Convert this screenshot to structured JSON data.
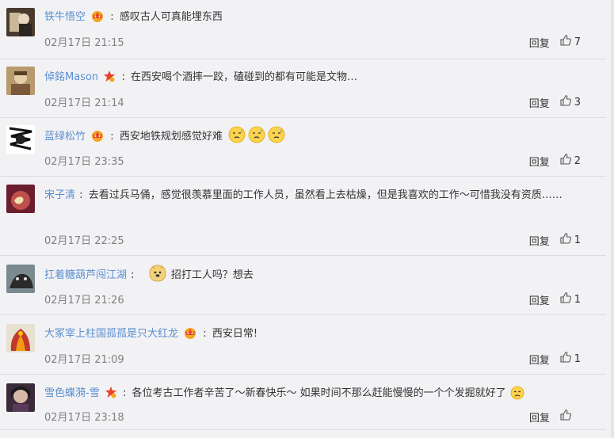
{
  "comments": [
    {
      "user": "铁牛悟空",
      "badge": "crown-badge",
      "text": "感叹古人可真能埋东西",
      "time": "02月17日 21:15",
      "reply_label": "回复",
      "likes": "7"
    },
    {
      "user": "倬銘Mason",
      "badge": "star-badge",
      "text": "在西安喝个酒摔一跤，磕碰到的都有可能是文物…",
      "time": "02月17日 21:14",
      "reply_label": "回复",
      "likes": "3"
    },
    {
      "user": "蓝绿松竹",
      "badge": "crown-badge",
      "text": "西安地铁规划感觉好难",
      "emojis": [
        "sweat-emoji",
        "sweat-emoji",
        "sweat-emoji"
      ],
      "time": "02月17日 23:35",
      "reply_label": "回复",
      "likes": "2"
    },
    {
      "user": "宋子清",
      "text": "去看过兵马俑，感觉很羡慕里面的工作人员，虽然看上去枯燥，但是我喜欢的工作～可惜我没有资质……",
      "time": "02月17日 22:25",
      "reply_label": "回复",
      "likes": "1"
    },
    {
      "user": "扛着糖葫芦闯江湖",
      "text": "招打工人吗？想去",
      "emojis": [
        "doge-emoji"
      ],
      "time": "02月17日 21:26",
      "reply_label": "回复",
      "likes": "1"
    },
    {
      "user": "大冢宰上柱国孤孤是只大红龙",
      "badge": "crown-badge",
      "text": "西安日常!",
      "time": "02月17日 21:09",
      "reply_label": "回复",
      "likes": "1"
    },
    {
      "user": "雪色蝶漪-雪",
      "badge": "star-badge",
      "text": "各位考古工作者辛苦了～新春快乐～ 如果时间不那么赶能慢慢的一个个发掘就好了",
      "emojis": [
        "sad-emoji"
      ],
      "time": "02月17日 23:18",
      "reply_label": "回复",
      "likes": ""
    }
  ],
  "colors": {
    "username": "#5b8fcf",
    "time": "#808080",
    "background": "#f2f2f5"
  }
}
